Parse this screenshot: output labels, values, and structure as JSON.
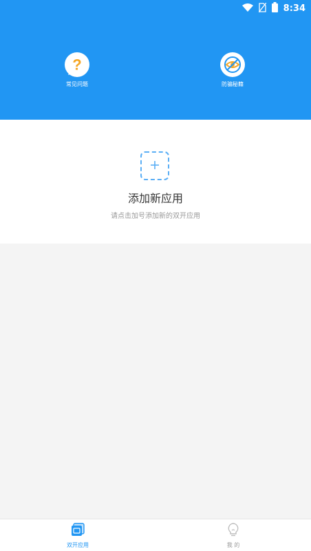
{
  "status_bar": {
    "time": "8:34"
  },
  "header": {
    "features": [
      {
        "label": "常见问题",
        "icon": "question-icon"
      },
      {
        "label": "防骗秘籍",
        "icon": "eye-blocked-icon"
      }
    ]
  },
  "add_app": {
    "title": "添加新应用",
    "subtitle": "请点击加号添加新的双开应用"
  },
  "bottom_nav": {
    "items": [
      {
        "label": "双开应用",
        "icon": "apps-icon",
        "active": true
      },
      {
        "label": "我 的",
        "icon": "bulb-icon",
        "active": false
      }
    ]
  },
  "colors": {
    "brand_blue": "#2196f3",
    "accent_orange": "#f5a623",
    "background_gray": "#f4f4f4"
  }
}
